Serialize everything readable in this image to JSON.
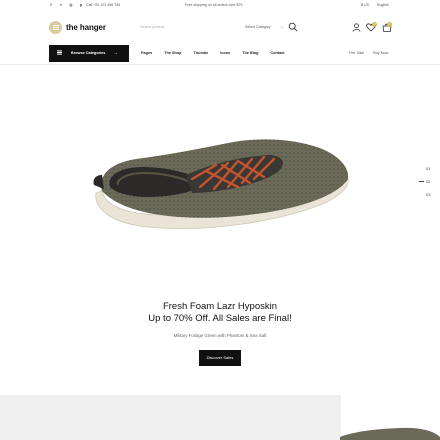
{
  "topbar": {
    "social": [
      "f",
      "t",
      "ig",
      "p"
    ],
    "phone": "Call +20 123 456 789",
    "shipping": "Free shipping on all orders over $75",
    "currency": "$ US",
    "language": "English"
  },
  "header": {
    "logo_text": "the hanger",
    "search_placeholder": "Search product",
    "category_select": "Select Category",
    "wishlist_count": "0",
    "cart_count": "0"
  },
  "nav": {
    "browse_label": "Browse Categories",
    "items": [
      "Pages",
      "The Shop",
      "Thumbs",
      "Icons",
      "The Blog",
      "Contact"
    ],
    "right": [
      "Fire Sale",
      "Buy Now"
    ]
  },
  "hero": {
    "title_line1": "Fresh Foam Lazr Hyposkin",
    "title_line2": "Up to 70% Off. All Sales are Final!",
    "subtitle": "Military Foliage Green with Phantom & Sea Salt",
    "cta": "Discover Sales",
    "slides": [
      "01",
      "02",
      "03"
    ],
    "active_slide": "02"
  },
  "colors": {
    "accent": "#d9b54a",
    "logo_badge": "#d9cba0",
    "dark": "#111111",
    "shoe_body": "#6b6a58",
    "laces": "#c2542e"
  }
}
